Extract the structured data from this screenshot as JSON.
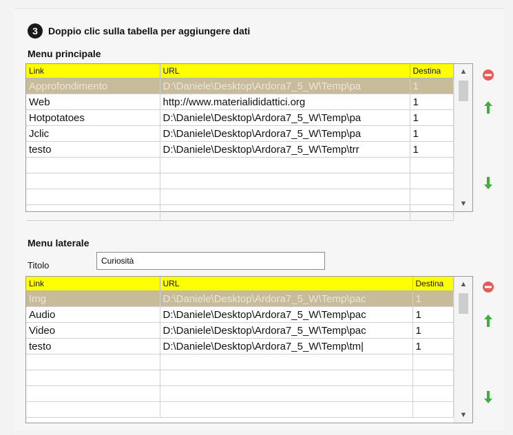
{
  "step": {
    "number": "3",
    "text": "Doppio clic sulla tabella per aggiungere dati"
  },
  "menu_principale": {
    "title": "Menu principale",
    "columns": [
      "Link",
      "URL",
      "Destina"
    ],
    "rows": [
      {
        "link": "Approfondimento",
        "url": "D:\\Daniele\\Desktop\\Ardora7_5_W\\Temp\\pa",
        "dest": "1",
        "selected": true
      },
      {
        "link": "Web",
        "url": "http://www.materialididattici.org",
        "dest": "1"
      },
      {
        "link": "Hotpotatoes",
        "url": "D:\\Daniele\\Desktop\\Ardora7_5_W\\Temp\\pa",
        "dest": "1"
      },
      {
        "link": "Jclic",
        "url": "D:\\Daniele\\Desktop\\Ardora7_5_W\\Temp\\pa",
        "dest": "1"
      },
      {
        "link": "testo",
        "url": "D:\\Daniele\\Desktop\\Ardora7_5_W\\Temp\\trr",
        "dest": "1"
      },
      {
        "link": "",
        "url": "",
        "dest": ""
      },
      {
        "link": "",
        "url": "",
        "dest": ""
      },
      {
        "link": "",
        "url": "",
        "dest": ""
      },
      {
        "link": "",
        "url": "",
        "dest": ""
      }
    ]
  },
  "menu_laterale": {
    "title": "Menu laterale",
    "titolo_label": "Titolo",
    "titolo_value": "Curiosità",
    "columns": [
      "Link",
      "URL",
      "Destina"
    ],
    "rows": [
      {
        "link": "Img",
        "url": "D:\\Daniele\\Desktop\\Ardora7_5_W\\Temp\\pac",
        "dest": "1",
        "selected": true
      },
      {
        "link": "Audio",
        "url": "D:\\Daniele\\Desktop\\Ardora7_5_W\\Temp\\pac",
        "dest": "1"
      },
      {
        "link": "Video",
        "url": "D:\\Daniele\\Desktop\\Ardora7_5_W\\Temp\\pac",
        "dest": "1"
      },
      {
        "link": "testo",
        "url": "D:\\Daniele\\Desktop\\Ardora7_5_W\\Temp\\tm|",
        "dest": "1"
      },
      {
        "link": "",
        "url": "",
        "dest": ""
      },
      {
        "link": "",
        "url": "",
        "dest": ""
      },
      {
        "link": "",
        "url": "",
        "dest": ""
      },
      {
        "link": "",
        "url": "",
        "dest": ""
      }
    ]
  },
  "icons": {
    "delete": "delete-icon",
    "move_up": "arrow-up-icon",
    "move_down": "arrow-down-icon"
  },
  "colors": {
    "header": "#ffff00",
    "selected_row": "#c8bb9a",
    "delete": "#e85a5a",
    "arrow": "#3fae3f"
  }
}
